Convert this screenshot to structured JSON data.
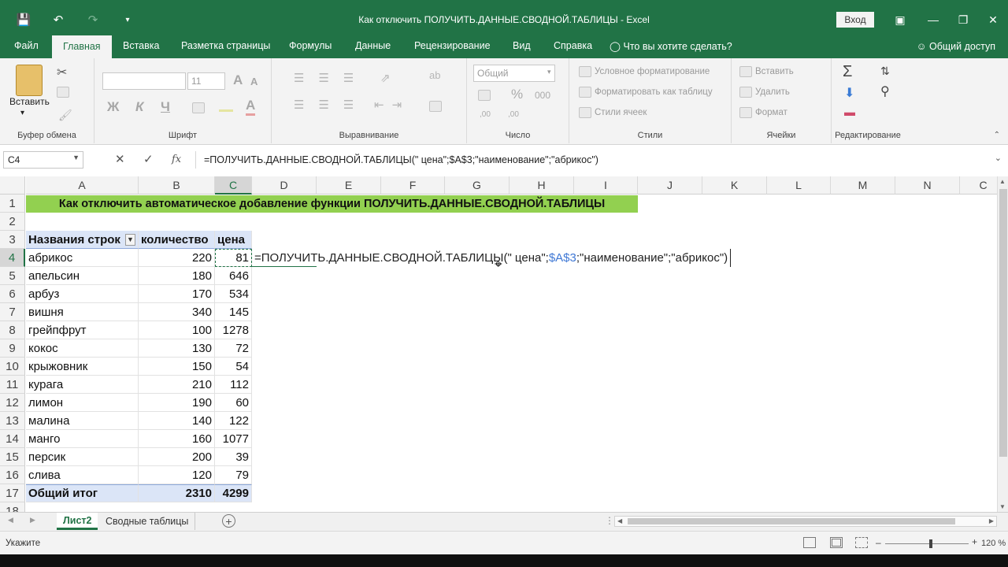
{
  "window": {
    "title": "Как отключить ПОЛУЧИТЬ.ДАННЫЕ.СВОДНОЙ.ТАБЛИЦЫ  -  Excel",
    "login": "Вход",
    "accent": "#217346"
  },
  "tabs": [
    "Файл",
    "Главная",
    "Вставка",
    "Разметка страницы",
    "Формулы",
    "Данные",
    "Рецензирование",
    "Вид",
    "Справка",
    "Что вы хотите сделать?"
  ],
  "share": "Общий доступ",
  "ribbon": {
    "clipboard": {
      "paste": "Вставить",
      "label": "Буфер обмена"
    },
    "font": {
      "size": "11",
      "bold": "Ж",
      "italic": "К",
      "underline": "Ч",
      "label": "Шрифт"
    },
    "alignment": {
      "label": "Выравнивание"
    },
    "number": {
      "format": "Общий",
      "label": "Число"
    },
    "styles": {
      "conditional": "Условное форматирование",
      "table": "Форматировать как таблицу",
      "cell_styles": "Стили ячеек",
      "label": "Стили"
    },
    "cells": {
      "insert": "Вставить",
      "delete": "Удалить",
      "format": "Формат",
      "label": "Ячейки"
    },
    "editing": {
      "label": "Редактирование"
    }
  },
  "formula_bar": {
    "name_box": "C4",
    "fx": "fx",
    "formula": "=ПОЛУЧИТЬ.ДАННЫЕ.СВОДНОЙ.ТАБЛИЦЫ(\" цена\";$A$3;\"наименование\";\"абрикос\")"
  },
  "columns": [
    "A",
    "B",
    "C",
    "D",
    "E",
    "F",
    "G",
    "H",
    "I",
    "J",
    "K",
    "L",
    "M",
    "N",
    "C"
  ],
  "rows": [
    "1",
    "2",
    "3",
    "4",
    "5",
    "6",
    "7",
    "8",
    "9",
    "10",
    "11",
    "12",
    "13",
    "14",
    "15",
    "16",
    "17",
    "18"
  ],
  "banner": "Как отключить автоматическое добавление функции ПОЛУЧИТЬ.ДАННЫЕ.СВОДНОЙ.ТАБЛИЦЫ",
  "pivot": {
    "headers": [
      "Названия строк",
      "количество",
      "цена"
    ],
    "rows": [
      [
        "абрикос",
        "220",
        "81"
      ],
      [
        "апельсин",
        "180",
        "646"
      ],
      [
        "арбуз",
        "170",
        "534"
      ],
      [
        "вишня",
        "340",
        "145"
      ],
      [
        "грейпфрут",
        "100",
        "1278"
      ],
      [
        "кокос",
        "130",
        "72"
      ],
      [
        "крыжовник",
        "150",
        "54"
      ],
      [
        "курага",
        "210",
        "112"
      ],
      [
        "лимон",
        "190",
        "60"
      ],
      [
        "малина",
        "140",
        "122"
      ],
      [
        "манго",
        "160",
        "1077"
      ],
      [
        "персик",
        "200",
        "39"
      ],
      [
        "слива",
        "120",
        "79"
      ]
    ],
    "total": [
      "Общий итог",
      "2310",
      "4299"
    ]
  },
  "cell_formula": {
    "part1": "=ПОЛУЧИТЬ.ДАННЫЕ.СВОДНОЙ.ТАБЛИЦЫ(\" цена\";",
    "ref": "$A$3",
    "part2": ";\"наименование\";\"абрикос\")"
  },
  "sheets": [
    "Лист2",
    "Сводные таблицы"
  ],
  "status": {
    "mode": "Укажите",
    "zoom": "120 %"
  }
}
